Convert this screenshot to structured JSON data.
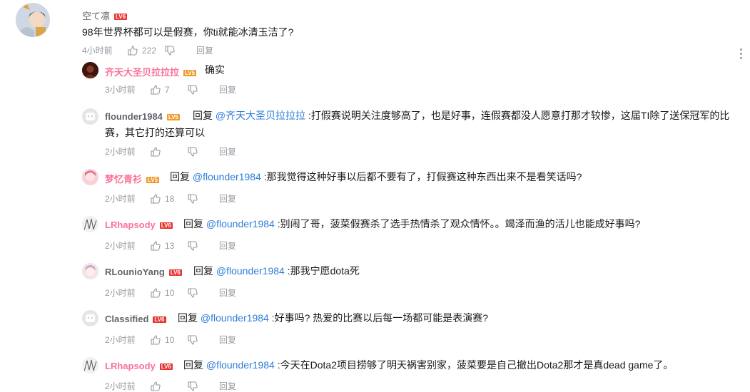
{
  "root": {
    "user": "空て凛",
    "level": "LV6",
    "text": "98年世界杯都可以是假赛，你ti就能冰清玉洁了?",
    "time": "4小时前",
    "likes": "222",
    "reply": "回复"
  },
  "replies": [
    {
      "user": "齐天大圣贝拉拉拉",
      "level": "LV5",
      "reply_kw": "",
      "at": "",
      "text": "确实",
      "time": "3小时前",
      "likes": "7",
      "reply": "回复"
    },
    {
      "user": "flounder1984",
      "level": "LV5",
      "reply_kw": "回复",
      "at": "@齐天大圣贝拉拉拉",
      "text": ":打假赛说明关注度够高了，也是好事，连假赛都没人愿意打那才较惨，这届TI除了送保冠军的比赛，其它打的还算可以",
      "time": "2小时前",
      "likes": "",
      "reply": "回复"
    },
    {
      "user": "梦忆青衫",
      "level": "LV5",
      "reply_kw": "回复",
      "at": "@flounder1984",
      "text": ":那我觉得这种好事以后都不要有了，打假赛这种东西出来不是看笑话吗?",
      "time": "2小时前",
      "likes": "18",
      "reply": "回复"
    },
    {
      "user": "LRhapsody",
      "level": "LV6",
      "reply_kw": "回复",
      "at": "@flounder1984",
      "text": ":别闹了哥，菠菜假赛杀了选手热情杀了观众情怀。。竭泽而渔的活儿也能成好事吗?",
      "time": "2小时前",
      "likes": "13",
      "reply": "回复"
    },
    {
      "user": "RLounioYang",
      "level": "LV6",
      "reply_kw": "回复",
      "at": "@flounder1984",
      "text": ":那我宁愿dota死",
      "time": "2小时前",
      "likes": "10",
      "reply": "回复"
    },
    {
      "user": "Classified",
      "level": "LV6",
      "reply_kw": "回复",
      "at": "@flounder1984",
      "text": ":好事吗? 热爱的比赛以后每一场都可能是表演赛?",
      "time": "2小时前",
      "likes": "10",
      "reply": "回复"
    },
    {
      "user": "LRhapsody",
      "level": "LV6",
      "reply_kw": "回复",
      "at": "@flounder1984",
      "text": ":今天在Dota2项目捞够了明天祸害别家，菠菜要是自己撤出Dota2那才是真dead game了。",
      "time": "2小时前",
      "likes": "",
      "reply": "回复"
    }
  ],
  "colors": {
    "uname_pink": "#fb7299",
    "uname_default": "#61666d",
    "at_link": "#2e7dd8",
    "lv6": "#e8342f",
    "lv5": "#f09a2b",
    "meta": "#9499a0"
  },
  "icons": [
    "thumb-up-icon",
    "thumb-down-icon",
    "more-dots-icon"
  ]
}
